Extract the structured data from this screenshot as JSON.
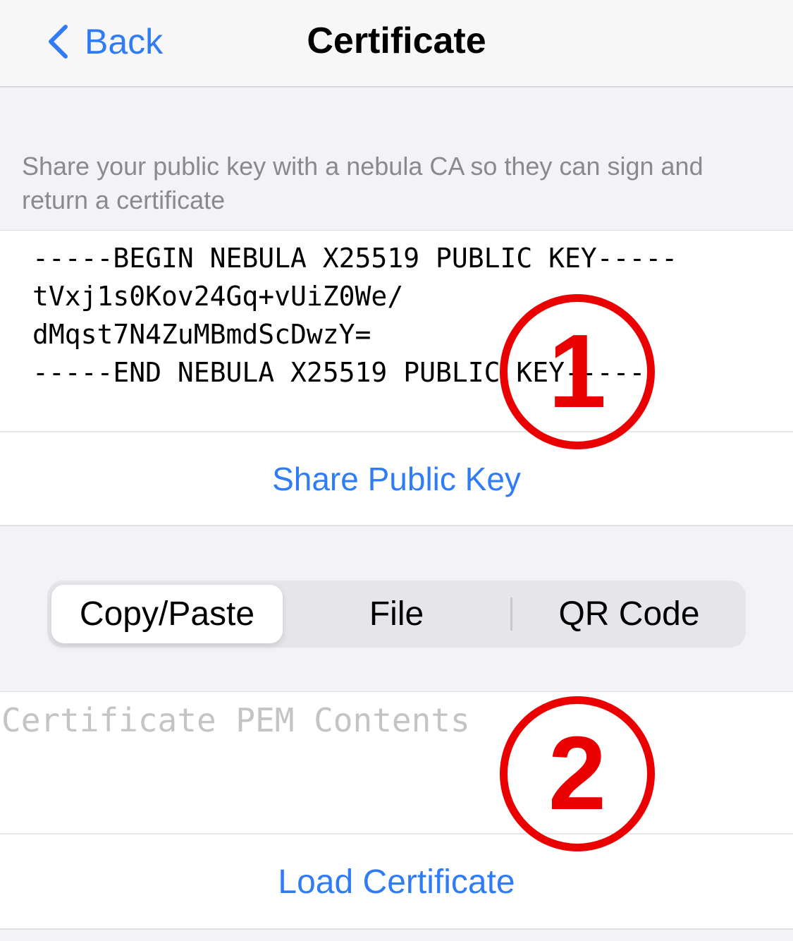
{
  "navbar": {
    "back_label": "Back",
    "title": "Certificate"
  },
  "key_section": {
    "header": "Share your public key with a nebula CA so they can sign and return a certificate",
    "public_key": "-----BEGIN NEBULA X25519 PUBLIC KEY-----\ntVxj1s0Kov24Gq+vUiZ0We/\ndMqst7N4ZuMBmdScDwzY=\n-----END NEBULA X25519 PUBLIC KEY-----",
    "share_label": "Share Public Key"
  },
  "segmented": {
    "options": [
      "Copy/Paste",
      "File",
      "QR Code"
    ],
    "selected": "Copy/Paste"
  },
  "pem_section": {
    "placeholder": "Certificate PEM Contents",
    "value": "",
    "load_label": "Load Certificate"
  },
  "annotations": {
    "marker_1": "1",
    "marker_2": "2"
  },
  "colors": {
    "accent": "#2f7cf6",
    "annotation": "#ea0000",
    "background": "#f2f2f7"
  }
}
